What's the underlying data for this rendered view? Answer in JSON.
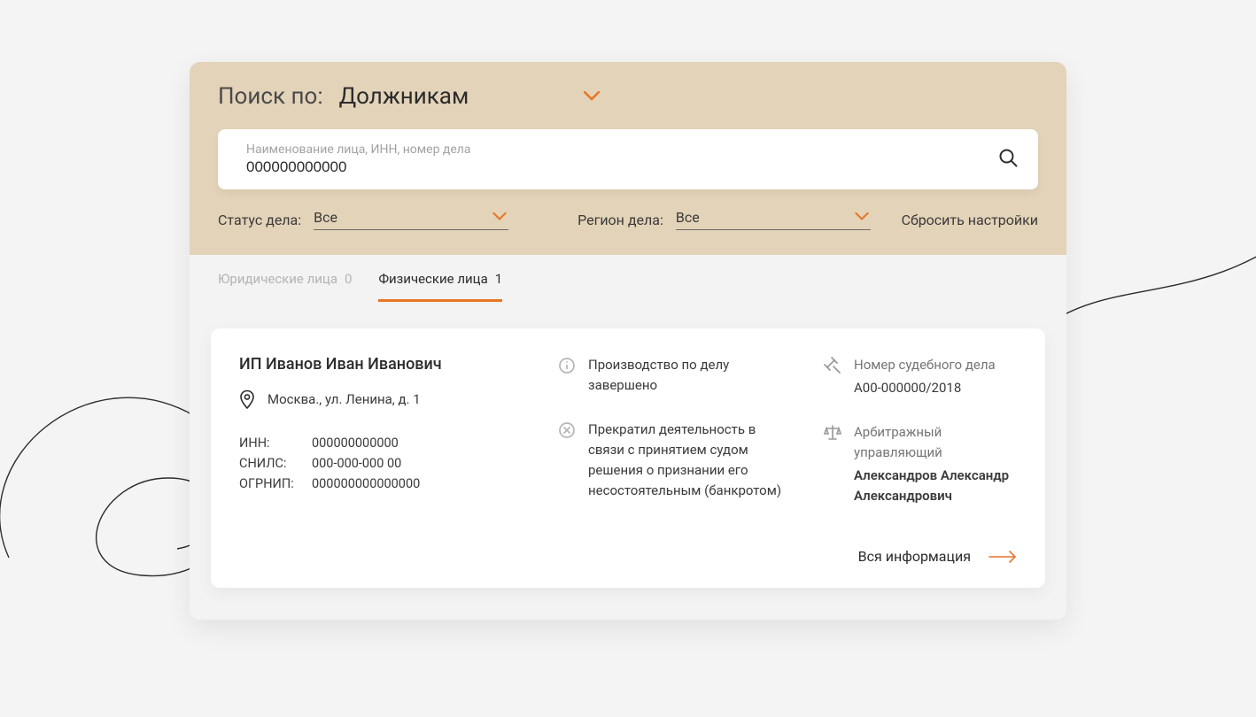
{
  "colors": {
    "accent": "#e87424",
    "beige": "#e3d3b8"
  },
  "search": {
    "title_label": "Поиск по:",
    "title_value": "Должникам",
    "placeholder": "Наименование лица, ИНН, номер дела",
    "value": "000000000000"
  },
  "filters": {
    "status_label": "Статус дела:",
    "status_value": "Все",
    "region_label": "Регион дела:",
    "region_value": "Все",
    "reset_label": "Сбросить настройки"
  },
  "tabs": [
    {
      "label": "Юридические лица",
      "count": "0",
      "active": false
    },
    {
      "label": "Физические лица",
      "count": "1",
      "active": true
    }
  ],
  "result": {
    "name": "ИП Иванов Иван Иванович",
    "address": "Москва., ул. Ленина, д. 1",
    "ids": {
      "inn_label": "ИНН:",
      "inn_value": "000000000000",
      "snils_label": "СНИЛС:",
      "snils_value": "000-000-000 00",
      "ogrnip_label": "ОГРНИП:",
      "ogrnip_value": "000000000000000"
    },
    "status_text": "Производство по делу завершено",
    "reason_text": "Прекратил деятельность в связи с принятием судом решения о признании его несостоятельным (банкротом)",
    "case": {
      "label": "Номер судебного дела",
      "value": "А00-000000/2018"
    },
    "manager": {
      "label": "Арбитражный управляющий",
      "value": "Александров Александр Александрович"
    },
    "more_label": "Вся информация"
  }
}
